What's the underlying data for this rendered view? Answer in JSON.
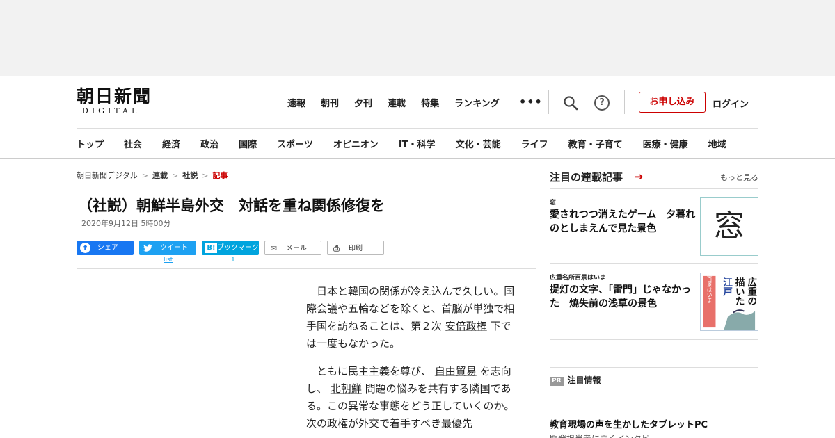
{
  "logo": {
    "main": "朝日新聞",
    "sub": "DIGITAL"
  },
  "topnav": [
    "速報",
    "朝刊",
    "夕刊",
    "連載",
    "特集",
    "ランキング"
  ],
  "more_icon": "•••",
  "help_glyph": "?",
  "apply_label": "お申し込み",
  "login_label": "ログイン",
  "catnav": [
    "トップ",
    "社会",
    "経済",
    "政治",
    "国際",
    "スポーツ",
    "オピニオン",
    "IT・科学",
    "文化・芸能",
    "ライフ",
    "教育・子育て",
    "医療・健康",
    "地域"
  ],
  "breadcrumb": {
    "home": "朝日新聞デジタル",
    "l2": "連載",
    "l3": "社説",
    "current": "記事",
    "separator": ">"
  },
  "article": {
    "title": "（社説）朝鮮半島外交　対話を重ね関係修復を",
    "date": "2020年9月12日 5時00分",
    "p1_a": "日本と韓国の関係が冷え込んで久しい。国際会議や五輪などを除くと、首脳が単独で相手国を訪ねることは、第２次",
    "p1_link": "安倍政権",
    "p1_b": "下では一度もなかった。",
    "p2_a": "ともに民主主義を尊び、",
    "p2_link1": "自由貿易",
    "p2_b": "を志向し、",
    "p2_link2": "北朝鮮",
    "p2_c": "問題の悩みを共有する隣国である。この異常な事態をどう正していくのか。次の政権が外交で着手すべき最優先"
  },
  "share": {
    "facebook": {
      "icon": "f",
      "label": "シェア"
    },
    "twitter": {
      "icon": "🐦",
      "label": "ツイート",
      "count": "list"
    },
    "hatena": {
      "icon": "B!",
      "label": "ブックマーク",
      "count": "1"
    },
    "mail": {
      "icon": "✉",
      "label": "メール"
    },
    "print": {
      "icon": "⎙",
      "label": "印刷"
    }
  },
  "sidebar": {
    "heading": "注目の連載記事",
    "heading_arrow": "➔",
    "more": "もっと見る",
    "items": [
      {
        "category": "窓",
        "title": "愛されつつ消えたゲーム　夕暮れのとしまえんで見た景色",
        "thumb_text": "窓"
      },
      {
        "category": "広重名所百景はいま",
        "title": "提灯の文字、「雷門」じゃなかった　焼失前の浅草の景色",
        "thumb_text": [
          "広重の",
          "描いた",
          "江戸",
          "名所百景はいま"
        ]
      }
    ],
    "pr_badge": "PR",
    "pr_label": "注目情報",
    "pr_title": "教育現場の声を生かしたタブレットPC",
    "pr_sub": "開発担当者に聞くインタビ"
  }
}
